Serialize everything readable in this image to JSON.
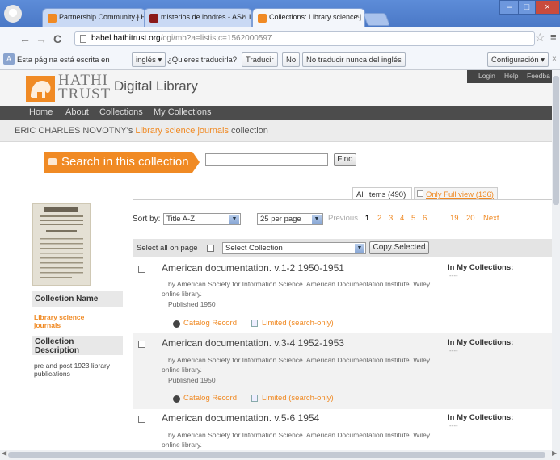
{
  "browser": {
    "tabs": [
      {
        "label": "Partnership Community | Hat"
      },
      {
        "label": "misterios de londres - ASU Li"
      },
      {
        "label": "Collections: Library science j"
      }
    ],
    "window_controls": {
      "minimize": "–",
      "maximize": "□",
      "close": "×"
    },
    "url_host": "babel.hathitrust.org",
    "url_path": "/cgi/mb?a=listis;c=1562000597",
    "translate": {
      "message": "Esta página está escrita en",
      "language": "inglés",
      "question": "¿Quieres traducirla?",
      "translate_btn": "Traducir",
      "no_btn": "No",
      "never_btn": "No traducir nunca del inglés",
      "settings_btn": "Configuración"
    }
  },
  "site": {
    "logo_line1": "HATHI",
    "logo_line2": "TRUST",
    "product": "Digital Library",
    "util_links": [
      "Login",
      "Help",
      "Feedba"
    ],
    "nav": [
      "Home",
      "About",
      "Collections",
      "My Collections"
    ],
    "breadcrumb": {
      "owner": "ERIC CHARLES NOVOTNY's",
      "collection": "Library science journals",
      "suffix": "collection"
    }
  },
  "search": {
    "label": "Search in this collection",
    "value": "",
    "find_btn": "Find"
  },
  "sidebar": {
    "name_heading": "Collection Name",
    "name_value": "Library science journals",
    "desc_heading": "Collection Description",
    "desc_value": "pre and post 1923 library publications"
  },
  "listing": {
    "all_items_tab": "All Items (490)",
    "full_view_tab": "Only Full view (136)",
    "sort_label": "Sort by:",
    "sort_value": "Title A-Z",
    "per_page_value": "25 per page",
    "pagination": {
      "previous": "Previous",
      "current": "1",
      "pages": [
        "2",
        "3",
        "4",
        "5",
        "6"
      ],
      "ellipsis": "...",
      "last_pages": [
        "19",
        "20"
      ],
      "next": "Next"
    },
    "select_all_label": "Select all on page",
    "select_collection": "Select Collection",
    "copy_selected_btn": "Copy Selected",
    "in_my_collections": "In My Collections:",
    "dash": "----",
    "catalog_record": "Catalog Record",
    "limited": "Limited (search-only)",
    "items": [
      {
        "title": "American documentation. v.1-2 1950-1951",
        "by_line1": "by American Society for Information Science. American Documentation Institute. Wiley",
        "by_line2": "online library.",
        "published": "Published 1950"
      },
      {
        "title": "American documentation. v.3-4 1952-1953",
        "by_line1": "by American Society for Information Science. American Documentation Institute. Wiley",
        "by_line2": "online library.",
        "published": "Published 1950"
      },
      {
        "title": "American documentation. v.5-6 1954",
        "by_line1": "by American Society for Information Science. American Documentation Institute. Wiley",
        "by_line2": "online library.",
        "published": ""
      }
    ]
  },
  "colors": {
    "brand_orange": "#f08a24",
    "nav_dark": "#4c4c4c",
    "chrome_blue": "#5d8cd8"
  }
}
